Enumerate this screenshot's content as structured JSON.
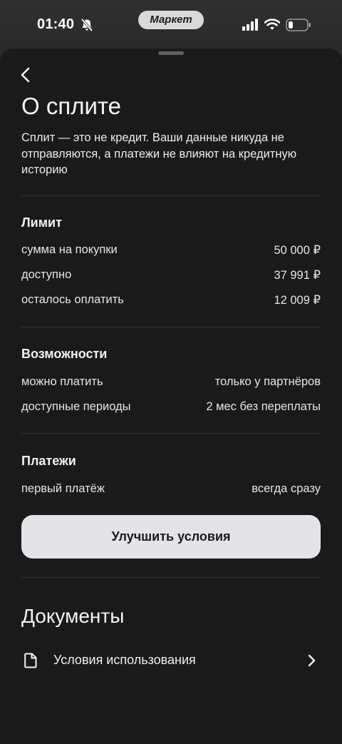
{
  "status_bar": {
    "time": "01:40",
    "app_pill": "Маркет"
  },
  "sheet": {
    "title": "О сплите",
    "intro": "Сплит — это не кредит. Ваши данные никуда не отправляются, а платежи не влияют на кредитную историю"
  },
  "limit": {
    "title": "Лимит",
    "rows": [
      {
        "label": "сумма на покупки",
        "value": "50 000 ₽"
      },
      {
        "label": "доступно",
        "value": "37 991 ₽"
      },
      {
        "label": "осталось оплатить",
        "value": "12 009 ₽"
      }
    ]
  },
  "features": {
    "title": "Возможности",
    "rows": [
      {
        "label": "можно платить",
        "value": "только у партнёров"
      },
      {
        "label": "доступные периоды",
        "value": "2 мес без переплаты"
      }
    ]
  },
  "payments": {
    "title": "Платежи",
    "rows": [
      {
        "label": "первый платёж",
        "value": "всегда сразу"
      }
    ],
    "improve_button": "Улучшить условия"
  },
  "documents": {
    "title": "Документы",
    "items": [
      {
        "label": "Условия использования",
        "icon": "document-icon"
      }
    ]
  },
  "colors": {
    "background": "#1a1a1a",
    "button": "#e4e4e8",
    "text": "#f2f2f2"
  }
}
